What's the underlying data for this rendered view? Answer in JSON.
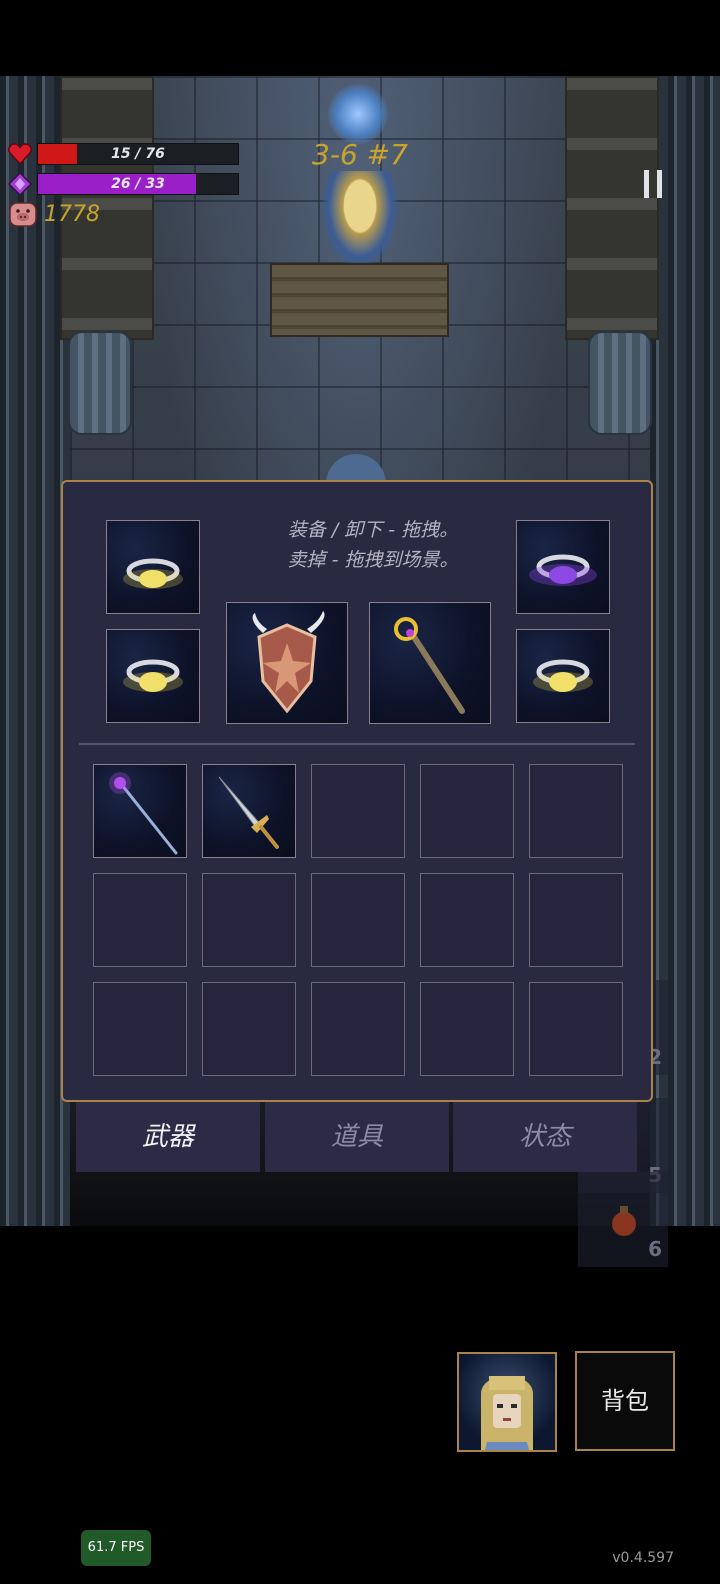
{
  "hud": {
    "hp_text": "15 / 76",
    "hp_current": 15,
    "hp_max": 76,
    "mp_text": "26 / 33",
    "mp_current": 26,
    "mp_max": 33,
    "gold": "1778",
    "stage": "3-6 #7",
    "colors": {
      "hp": "#d01818",
      "mp": "#9a1fc9",
      "gold": "#c9a42a"
    }
  },
  "side_slots": [
    {
      "count": "2"
    },
    {
      "count": "5"
    },
    {
      "count": "6"
    }
  ],
  "inventory": {
    "hint_line1": "装备 / 卸下 - 拖拽。",
    "hint_line2": "卖掉 - 拖拽到场景。",
    "equipped": [
      {
        "icon": "ring-gold-icon"
      },
      {
        "icon": "ring-purple-icon"
      },
      {
        "icon": "ring-gold-icon"
      },
      {
        "icon": "winged-shield-icon"
      },
      {
        "icon": "golden-staff-icon"
      },
      {
        "icon": "ring-gold-icon"
      }
    ],
    "bag_items": [
      {
        "icon": "purple-wand-icon"
      },
      {
        "icon": "silver-sword-icon"
      }
    ],
    "bag_slots_total": 15
  },
  "tabs": [
    {
      "label": "武器",
      "active": true
    },
    {
      "label": "道具",
      "active": false
    },
    {
      "label": "状态",
      "active": false
    }
  ],
  "bag_button": "背包",
  "fps": "61.7 FPS",
  "version": "v0.4.597"
}
